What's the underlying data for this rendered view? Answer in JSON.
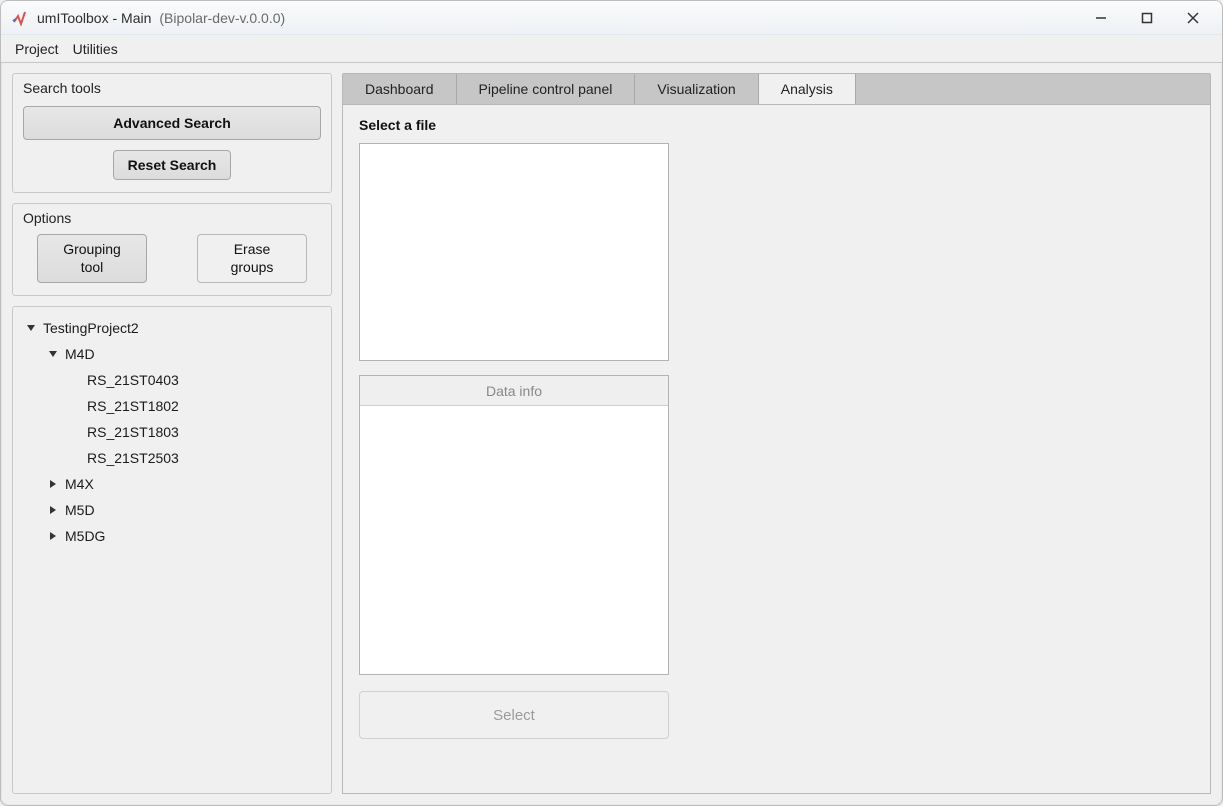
{
  "window": {
    "title": "umIToolbox - Main",
    "subtitle": "(Bipolar-dev-v.0.0.0)"
  },
  "menubar": {
    "items": [
      "Project",
      "Utilities"
    ]
  },
  "sidebar": {
    "search_tools": {
      "title": "Search tools",
      "advanced_label": "Advanced Search",
      "reset_label": "Reset Search"
    },
    "options": {
      "title": "Options",
      "grouping_label_line1": "Grouping",
      "grouping_label_line2": "tool",
      "erase_label_line1": "Erase",
      "erase_label_line2": "groups"
    },
    "tree": {
      "root": {
        "label": "TestingProject2",
        "expanded": true,
        "children": [
          {
            "label": "M4D",
            "expanded": true,
            "children": [
              {
                "label": "RS_21ST0403"
              },
              {
                "label": "RS_21ST1802"
              },
              {
                "label": "RS_21ST1803"
              },
              {
                "label": "RS_21ST2503"
              }
            ]
          },
          {
            "label": "M4X",
            "expanded": false
          },
          {
            "label": "M5D",
            "expanded": false
          },
          {
            "label": "M5DG",
            "expanded": false
          }
        ]
      }
    }
  },
  "tabs": {
    "items": [
      "Dashboard",
      "Pipeline control panel",
      "Visualization",
      "Analysis"
    ],
    "active_index": 3
  },
  "analysis": {
    "select_file_label": "Select a file",
    "data_info_header": "Data info",
    "select_button_label": "Select"
  }
}
